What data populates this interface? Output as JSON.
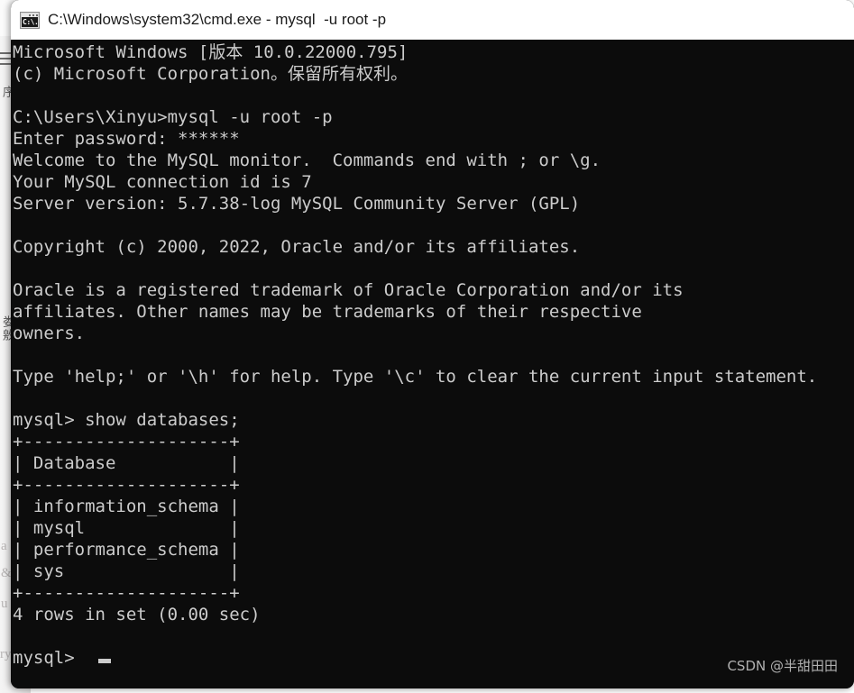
{
  "window": {
    "title": "C:\\Windows\\system32\\cmd.exe - mysql  -u root -p",
    "icon_name": "cmd-exe-icon",
    "icon_glyph": "C:\\.",
    "background_color": "#0c0c0c",
    "text_color": "#cccccc",
    "titlebar_color": "#ffffff"
  },
  "background_window": {
    "hamburger_icon": "hamburger-menu-icon",
    "vertical_label_top": "序",
    "vertical_label_mid": "娄敫",
    "faint_text_a": "a",
    "faint_text_amp": "&",
    "faint_text_u": "u",
    "faint_text_ry": "ry"
  },
  "terminal": {
    "lines": [
      "Microsoft Windows [版本 10.0.22000.795]",
      "(c) Microsoft Corporation。保留所有权利。",
      "",
      "C:\\Users\\Xinyu>mysql -u root -p",
      "Enter password: ******",
      "Welcome to the MySQL monitor.  Commands end with ; or \\g.",
      "Your MySQL connection id is 7",
      "Server version: 5.7.38-log MySQL Community Server (GPL)",
      "",
      "Copyright (c) 2000, 2022, Oracle and/or its affiliates.",
      "",
      "Oracle is a registered trademark of Oracle Corporation and/or its",
      "affiliates. Other names may be trademarks of their respective",
      "owners.",
      "",
      "Type 'help;' or '\\h' for help. Type '\\c' to clear the current input statement.",
      "",
      "mysql> show databases;",
      "+--------------------+",
      "| Database           |",
      "+--------------------+",
      "| information_schema |",
      "| mysql              |",
      "| performance_schema |",
      "| sys                |",
      "+--------------------+",
      "4 rows in set (0.00 sec)",
      "",
      "mysql>"
    ],
    "cursor": "block-cursor"
  },
  "watermark": {
    "text": "CSDN @半甜田田"
  }
}
